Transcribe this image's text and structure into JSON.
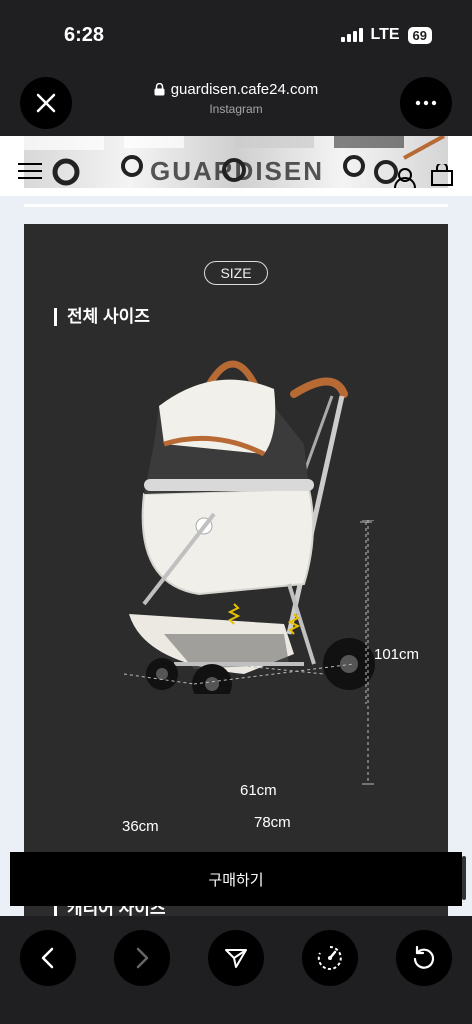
{
  "status": {
    "time": "6:28",
    "network": "LTE",
    "battery": "69"
  },
  "browser": {
    "url": "guardisen.cafe24.com",
    "source": "Instagram",
    "close_icon": "close-icon",
    "more_icon": "more-icon"
  },
  "banner": {
    "brand": "GUARDISEN"
  },
  "content": {
    "size_badge": "SIZE",
    "total_size_title": "전체 사이즈",
    "dimensions": {
      "height": "101cm",
      "wheelbase": "61cm",
      "length": "78cm",
      "width": "36cm"
    },
    "carrier_size_title": "캐리어 사이즈"
  },
  "purchase": {
    "label": "구매하기"
  },
  "toolbar": {
    "back_icon": "back-arrow-icon",
    "forward_icon": "forward-arrow-icon",
    "share_icon": "send-icon",
    "speed_icon": "speed-gauge-icon",
    "reload_icon": "reload-icon"
  },
  "colors": {
    "panel": "#2c2c2c",
    "chrome": "#1f1f21",
    "accent_leather": "#b86a35",
    "page_bg": "#ebeff6"
  }
}
